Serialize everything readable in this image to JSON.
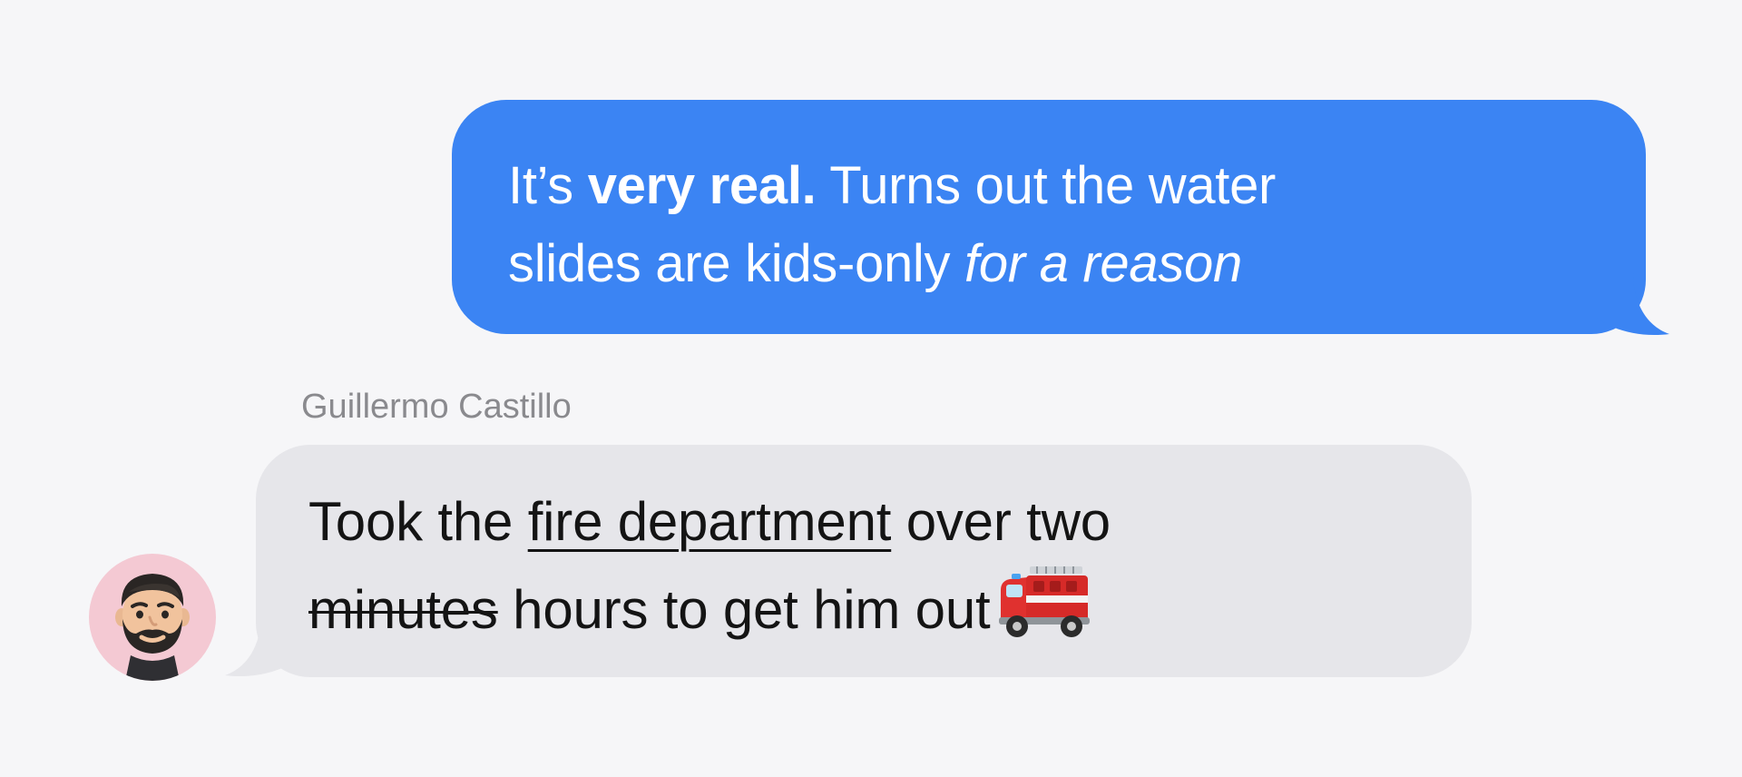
{
  "messages": [
    {
      "direction": "outgoing",
      "bubble_color": "#3b84f3",
      "line1": {
        "part1": "It’s ",
        "part2_bold": "very real.",
        "part3": " Turns out the water"
      },
      "line2": {
        "part1": "slides are kids-only ",
        "part2_italic": "for a reason"
      }
    },
    {
      "direction": "incoming",
      "bubble_color": "#e6e6ea",
      "sender": "Guillermo Castillo",
      "avatar_icon": "memoji-bearded-man-icon",
      "line1": {
        "part1": "Took the ",
        "part2_underline": "fire department",
        "part3": " over two"
      },
      "line2": {
        "part1_strikethrough": "minutes",
        "part2": " hours to get him out",
        "emoji": "fire-engine-emoji-icon"
      }
    }
  ]
}
